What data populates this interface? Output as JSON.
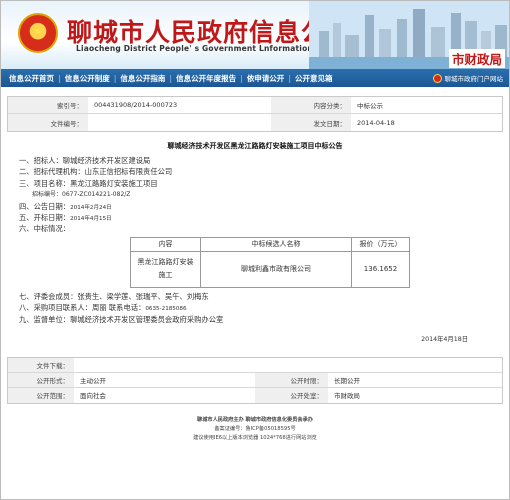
{
  "header": {
    "title": "聊城市人民政府信息公开",
    "subtitle": "Liaocheng District People' s Government Lnformation Catalogue",
    "department": "市财政局",
    "emblem_glyph": "★"
  },
  "nav": {
    "items": [
      "信息公开首页",
      "信息公开制度",
      "信息公开指南",
      "信息公开年度报告",
      "依申请公开",
      "公开意见箱"
    ],
    "portal_link": "聊城市政府门户网站"
  },
  "info": {
    "index_label": "索引号：",
    "index_value": "004431908/2014-000723",
    "category_label": "内容分类：",
    "category_value": "中标公示",
    "doc_label": "文件编号：",
    "doc_value": "",
    "date_label": "发文日期：",
    "date_value": "2014-04-18"
  },
  "article": {
    "title": "聊城经济技术开发区黑龙江路路灯安装施工项目中标公告",
    "lines": [
      "一、招标人：聊城经济技术开发区建设局",
      "二、招标代理机构：山东正信招标有限责任公司",
      "三、项目名称：黑龙江路路灯安装施工项目"
    ],
    "bid_no": "招标编号：0677-ZC014221-082/Z",
    "announce_label": "四、公告日期：",
    "announce_date": "2014年2月24日",
    "open_label": "五、开标日期：",
    "open_date": "2014年4月15日",
    "results_label": "六、中标情况："
  },
  "awards": {
    "headers": [
      "内容",
      "中标候选人名称",
      "报价（万元）"
    ],
    "rows": [
      {
        "content": "黑龙江路路灯安装施工",
        "name": "聊城利鑫市政有限公司",
        "price": "136.1652"
      }
    ]
  },
  "article2": {
    "committee": "七、评委会成员：张贵生、梁学莲、张瑞平、吴午、刘梅东",
    "contact_label": "八、采购项目联系人：周丽  联系电话：",
    "contact_phone": "0635-2185086",
    "supervisor": "九、监督单位：聊城经济技术开发区管理委员会政府采购办公室",
    "sign_date": "2014年4月18日"
  },
  "footer_table": {
    "doc_label": "文件下载：",
    "doc_value": "",
    "subject_label": "公开形式：",
    "subject_value": "主动公开",
    "term_label": "公开时限：",
    "term_value": "长期公开",
    "scope_label": "公开范围：",
    "scope_value": "面向社会",
    "issuer_label": "公开处室：",
    "issuer_value": "市财政局"
  },
  "footer": {
    "line1": "聊城市人民政府主办  聊城市政府信息化委员会承办",
    "line2": "备案证编号：鲁ICP备05018595号",
    "line3": "建议使用IE6以上版本浏览器 1024*768进行网站浏览"
  },
  "colors": {
    "title_red": "#c01818",
    "nav_blue": "#1b5693"
  }
}
